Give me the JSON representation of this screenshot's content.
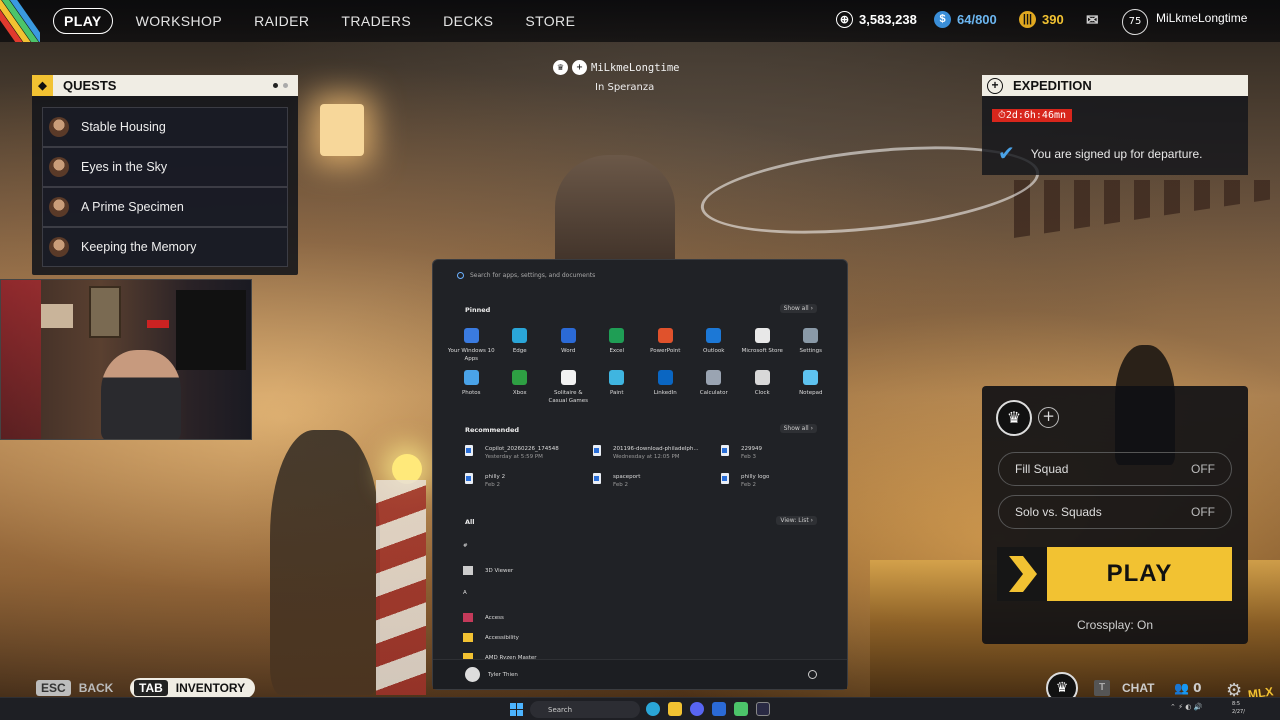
{
  "nav": {
    "play": "PLAY",
    "items": [
      "WORKSHOP",
      "RAIDER",
      "TRADERS",
      "DECKS",
      "STORE"
    ]
  },
  "resources": {
    "credits": "3,583,238",
    "cred_icon": "coin-icon",
    "capacity": "64/800",
    "raider_tokens": "390",
    "mail_icon": "mail-icon"
  },
  "profile": {
    "level": "75",
    "name": "MiLkmeLongtime"
  },
  "quests": {
    "title": "QUESTS",
    "items": [
      {
        "label": "Stable Housing"
      },
      {
        "label": "Eyes in the Sky"
      },
      {
        "label": "A Prime Specimen"
      },
      {
        "label": "Keeping the Memory"
      }
    ]
  },
  "player_tag": {
    "name": "MiLkmeLongtime",
    "location": "In Speranza"
  },
  "expedition": {
    "title": "EXPEDITION",
    "timer": "2d:6h:46mn",
    "status": "You are signed up for departure."
  },
  "start_menu": {
    "search_placeholder": "Search for apps, settings, and documents",
    "pinned_label": "Pinned",
    "show_all": "Show all",
    "pinned": [
      {
        "label": "Your Windows 10 Apps",
        "color": "#3a7be0"
      },
      {
        "label": "Edge",
        "color": "#2aa6d8"
      },
      {
        "label": "Word",
        "color": "#2b6ad6"
      },
      {
        "label": "Excel",
        "color": "#1f9e55"
      },
      {
        "label": "PowerPoint",
        "color": "#e0522c"
      },
      {
        "label": "Outlook",
        "color": "#1c78d6"
      },
      {
        "label": "Microsoft Store",
        "color": "#e8e8e8"
      },
      {
        "label": "Settings",
        "color": "#8a9aa8"
      },
      {
        "label": "Photos",
        "color": "#4aa3e8"
      },
      {
        "label": "Xbox",
        "color": "#2ea043"
      },
      {
        "label": "Solitaire & Casual Games",
        "color": "#f2f2f2"
      },
      {
        "label": "Paint",
        "color": "#3fb5e0"
      },
      {
        "label": "LinkedIn",
        "color": "#0a66c2"
      },
      {
        "label": "Calculator",
        "color": "#9aa4b2"
      },
      {
        "label": "Clock",
        "color": "#d8d8d8"
      },
      {
        "label": "Notepad",
        "color": "#5ec3f0"
      }
    ],
    "recommended_label": "Recommended",
    "recommended": [
      {
        "name": "Copilot_20260226_174548",
        "sub": "Yesterday at 5:59 PM"
      },
      {
        "name": "201196-download-philadelph...",
        "sub": "Wednesday at 12:05 PM"
      },
      {
        "name": "229949",
        "sub": "Feb 3"
      },
      {
        "name": "philly 2",
        "sub": "Feb 2"
      },
      {
        "name": "spaceport",
        "sub": "Feb 2"
      },
      {
        "name": "philly logo",
        "sub": "Feb 2"
      }
    ],
    "all_label": "All",
    "view_label": "View: List",
    "all_items": [
      {
        "label": "#",
        "kind": "header"
      },
      {
        "label": "3D Viewer",
        "kind": "app",
        "color": "#cccccc"
      },
      {
        "label": "A",
        "kind": "header"
      },
      {
        "label": "Access",
        "kind": "app",
        "color": "#c43a5a"
      },
      {
        "label": "Accessibility",
        "kind": "app",
        "color": "#f2c232"
      },
      {
        "label": "AMD Ryzen Master",
        "kind": "app",
        "color": "#f2c232"
      }
    ],
    "user_name": "Tyler Thien"
  },
  "squad": {
    "fill_squad": "Fill Squad",
    "fill_squad_value": "OFF",
    "solo_vs_squads": "Solo vs. Squads",
    "solo_vs_squads_value": "OFF",
    "play": "PLAY",
    "crossplay": "Crossplay: On"
  },
  "bottom": {
    "esc_key": "ESC",
    "back": "BACK",
    "tab_key": "TAB",
    "inventory": "INVENTORY",
    "chat_key": "T",
    "chat": "CHAT",
    "friends_count": "0"
  },
  "taskbar": {
    "search": "Search",
    "clock_time": "8:5",
    "clock_date": "2/27/"
  }
}
